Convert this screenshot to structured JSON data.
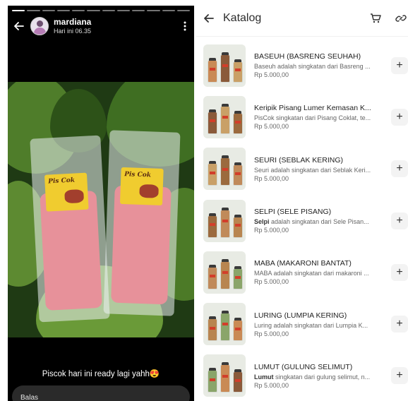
{
  "story": {
    "user_name": "mardiana",
    "timestamp": "Hari ini 06.35",
    "caption": "Piscok hari ini ready lagi yahh😍",
    "reply_placeholder": "Balas",
    "progress_segments": 12,
    "progress_current": 1
  },
  "catalog": {
    "title": "Katalog",
    "icons": {
      "back": "arrow-left-icon",
      "cart": "cart-icon",
      "link": "link-icon"
    },
    "items": [
      {
        "title": "BASEUH (BASRENG SEUHAH)",
        "desc_bold": "",
        "desc": "Baseuh adalah singkatan dari Basreng ...",
        "price": "Rp 5.000,00"
      },
      {
        "title": "Keripik Pisang Lumer Kemasan K...",
        "desc_bold": "",
        "desc": "PisCok singkatan dari Pisang Coklat, te...",
        "price": "Rp 5.000,00"
      },
      {
        "title": "SEURI (SEBLAK KERING)",
        "desc_bold": "",
        "desc": "Seuri adalah singkatan dari Seblak Keri...",
        "price": "Rp 5.000,00"
      },
      {
        "title": "SELPI (SELE PISANG)",
        "desc_bold": "Selpi",
        "desc": " adalah singkatan dari Sele Pisan...",
        "price": "Rp 5.000,00"
      },
      {
        "title": "MABA (MAKARONI BANTAT)",
        "desc_bold": "",
        "desc": "MABA adalah singkatan dari makaroni ...",
        "price": "Rp 5.000,00"
      },
      {
        "title": "LURING (LUMPIA KERING)",
        "desc_bold": "",
        "desc": "Luring adalah singkatan dari Lumpia K...",
        "price": "Rp 5.000,00"
      },
      {
        "title": "LUMUT (GULUNG SELIMUT)",
        "desc_bold": "Lumut",
        "desc": " singkatan dari gulung selimut, n...",
        "price": "Rp 5.000,00"
      }
    ],
    "add_label": "+"
  }
}
